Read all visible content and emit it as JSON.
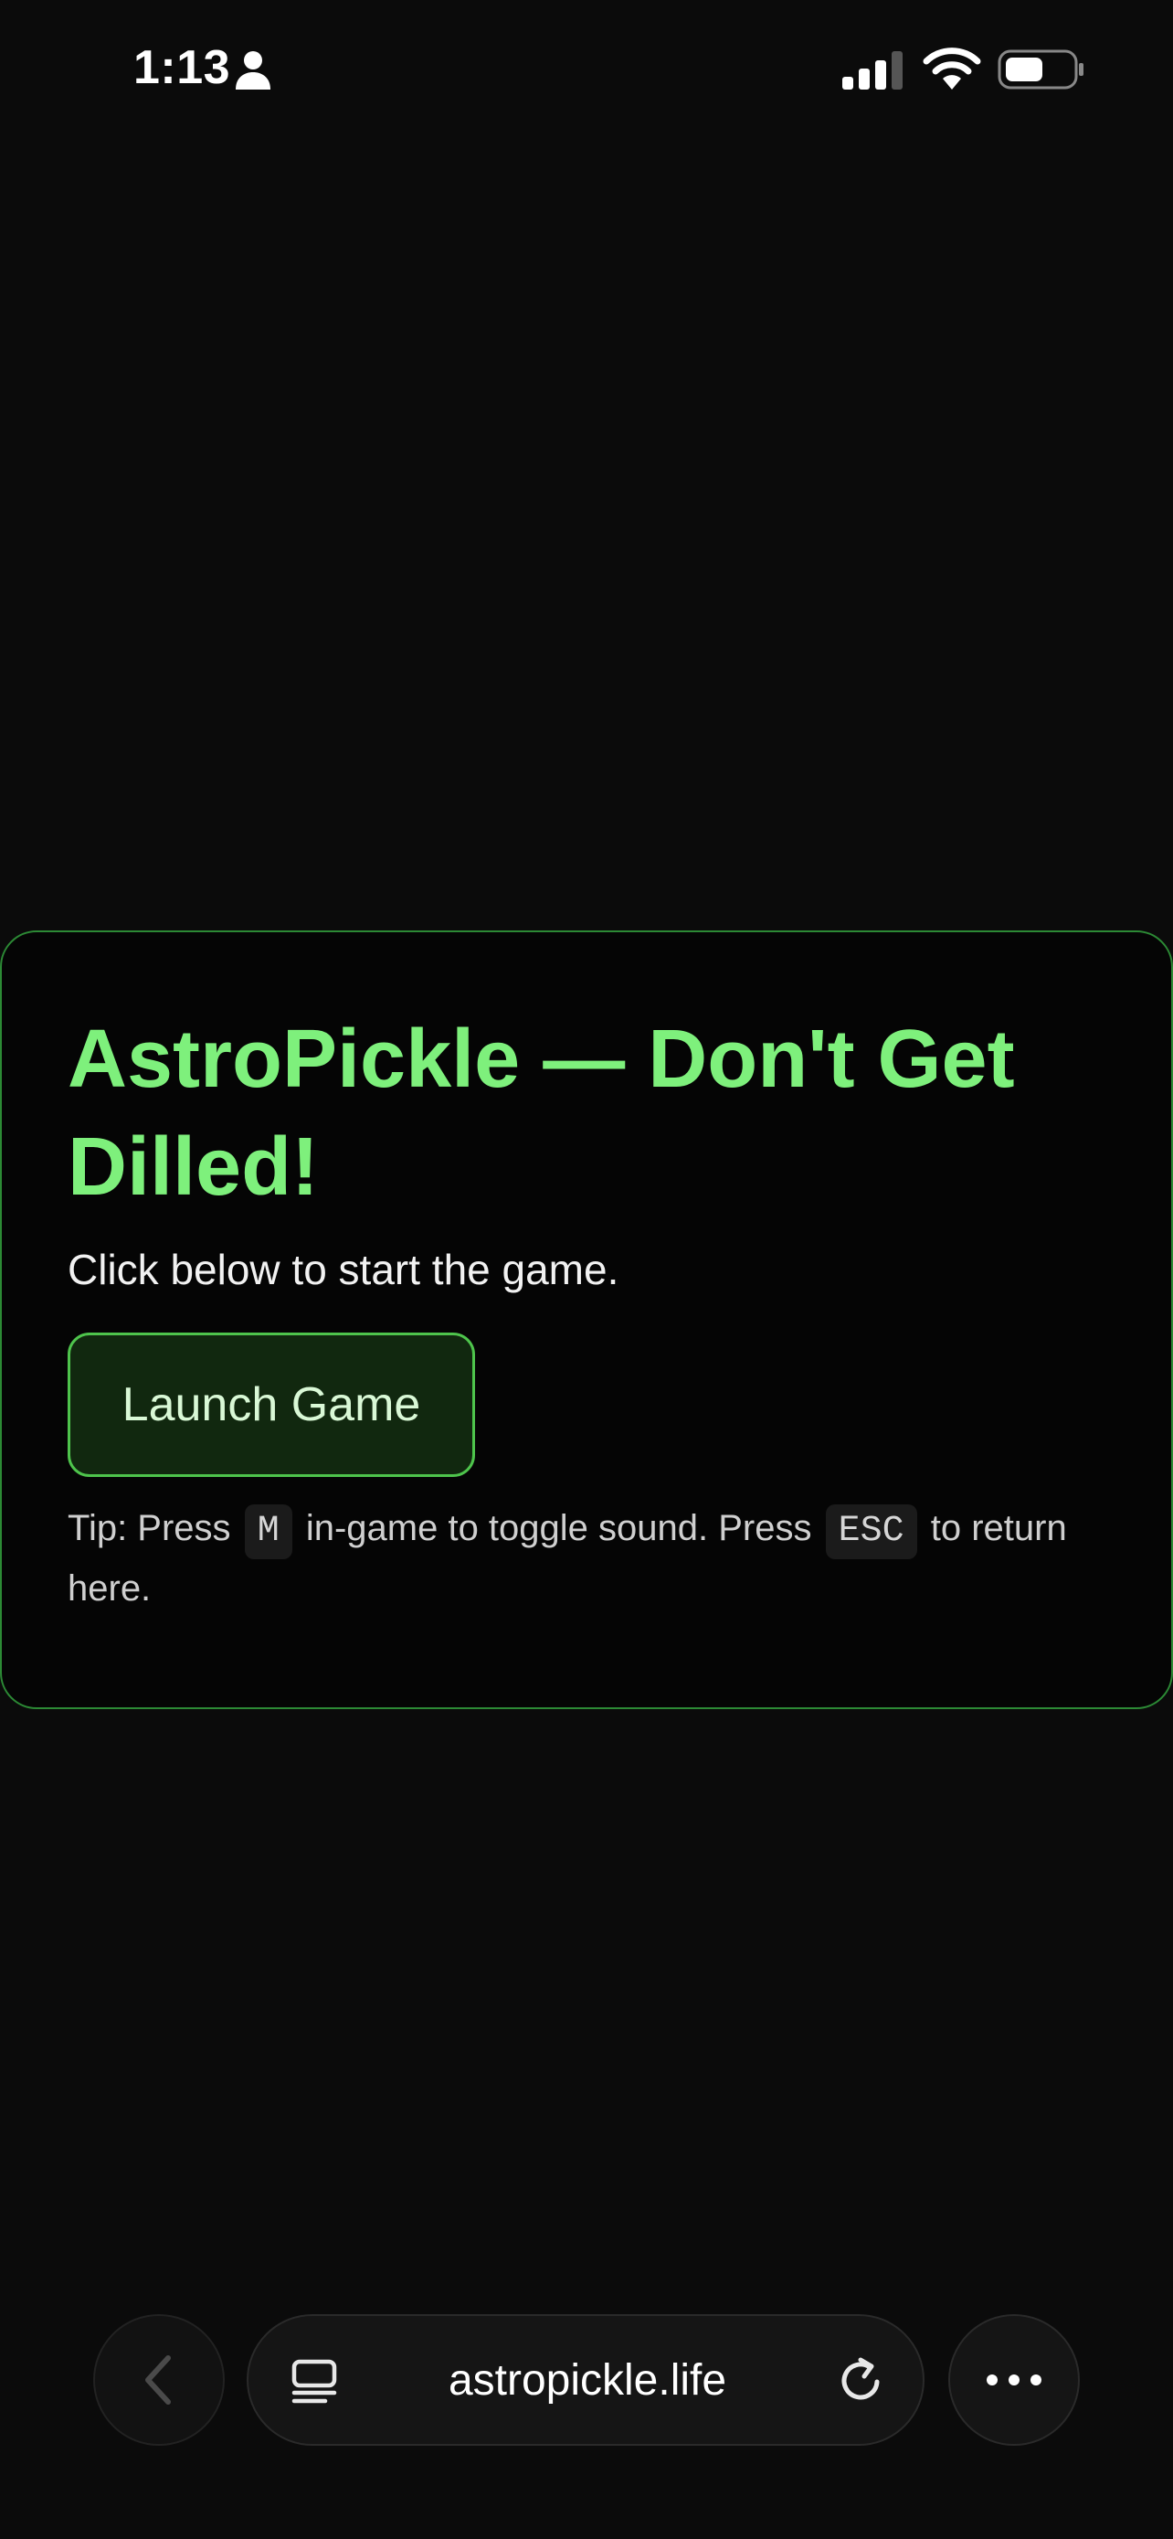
{
  "status_bar": {
    "time": "1:13",
    "icons": [
      "person-icon",
      "cellular-signal-icon",
      "wifi-icon",
      "battery-icon"
    ]
  },
  "card": {
    "title": "AstroPickle — Don't Get Dilled!",
    "subtitle": "Click below to start the game.",
    "button_label": "Launch Game",
    "tip": {
      "part1": "Tip: Press",
      "key1": "M",
      "part2": "in-game to toggle sound. Press",
      "key2": "ESC",
      "part3": "to return here."
    }
  },
  "browser": {
    "url": "astropickle.life",
    "icons": [
      "back-chevron-icon",
      "tabs-icon",
      "reload-icon",
      "more-dots-icon"
    ]
  },
  "colors": {
    "background": "#0b0b0b",
    "card_background": "#050505",
    "card_border": "#2c8a35",
    "accent_green": "#7ef07c",
    "button_fill": "#11280f",
    "button_border": "#4ec44c"
  }
}
